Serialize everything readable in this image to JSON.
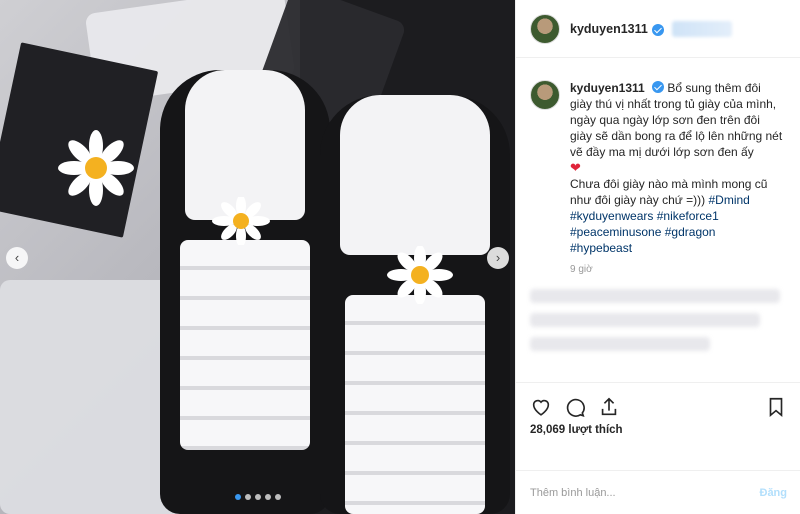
{
  "post": {
    "username": "kyduyen1311",
    "caption_text": "Bổ sung thêm đôi giày thú vị nhất trong tủ giày của mình, ngày qua ngày lớp sơn đen trên đôi giày sẽ dần bong ra để lộ lên những nét vẽ đầy ma mị dưới lớp sơn đen ấy",
    "caption_heart": "❤",
    "caption_text2": "Chưa đôi giày nào mà mình mong cũ như đôi giày này chứ =)))",
    "hashtags_line1": [
      "#Dmind"
    ],
    "hashtags_line2": [
      "#kyduyenwears",
      "#nikeforce1"
    ],
    "hashtags_line3": [
      "#peaceminusone",
      "#gdragon"
    ],
    "hashtags_line4": [
      "#hypebeast"
    ],
    "time": "9 giờ",
    "likes": "28,069 lượt thích",
    "comment_placeholder": "Thêm bình luận...",
    "post_button": "Đăng"
  },
  "carousel": {
    "total": 5,
    "active_index": 0
  },
  "icons": {
    "like": "heart-outline-icon",
    "comment": "comment-bubble-icon",
    "share": "share-arrow-icon",
    "save": "bookmark-icon",
    "verified": "verified-badge-icon",
    "prev": "chevron-left-icon",
    "next": "chevron-right-icon"
  },
  "colors": {
    "accent": "#3897f0",
    "heart": "#e0243a",
    "hashtag": "#003569"
  }
}
